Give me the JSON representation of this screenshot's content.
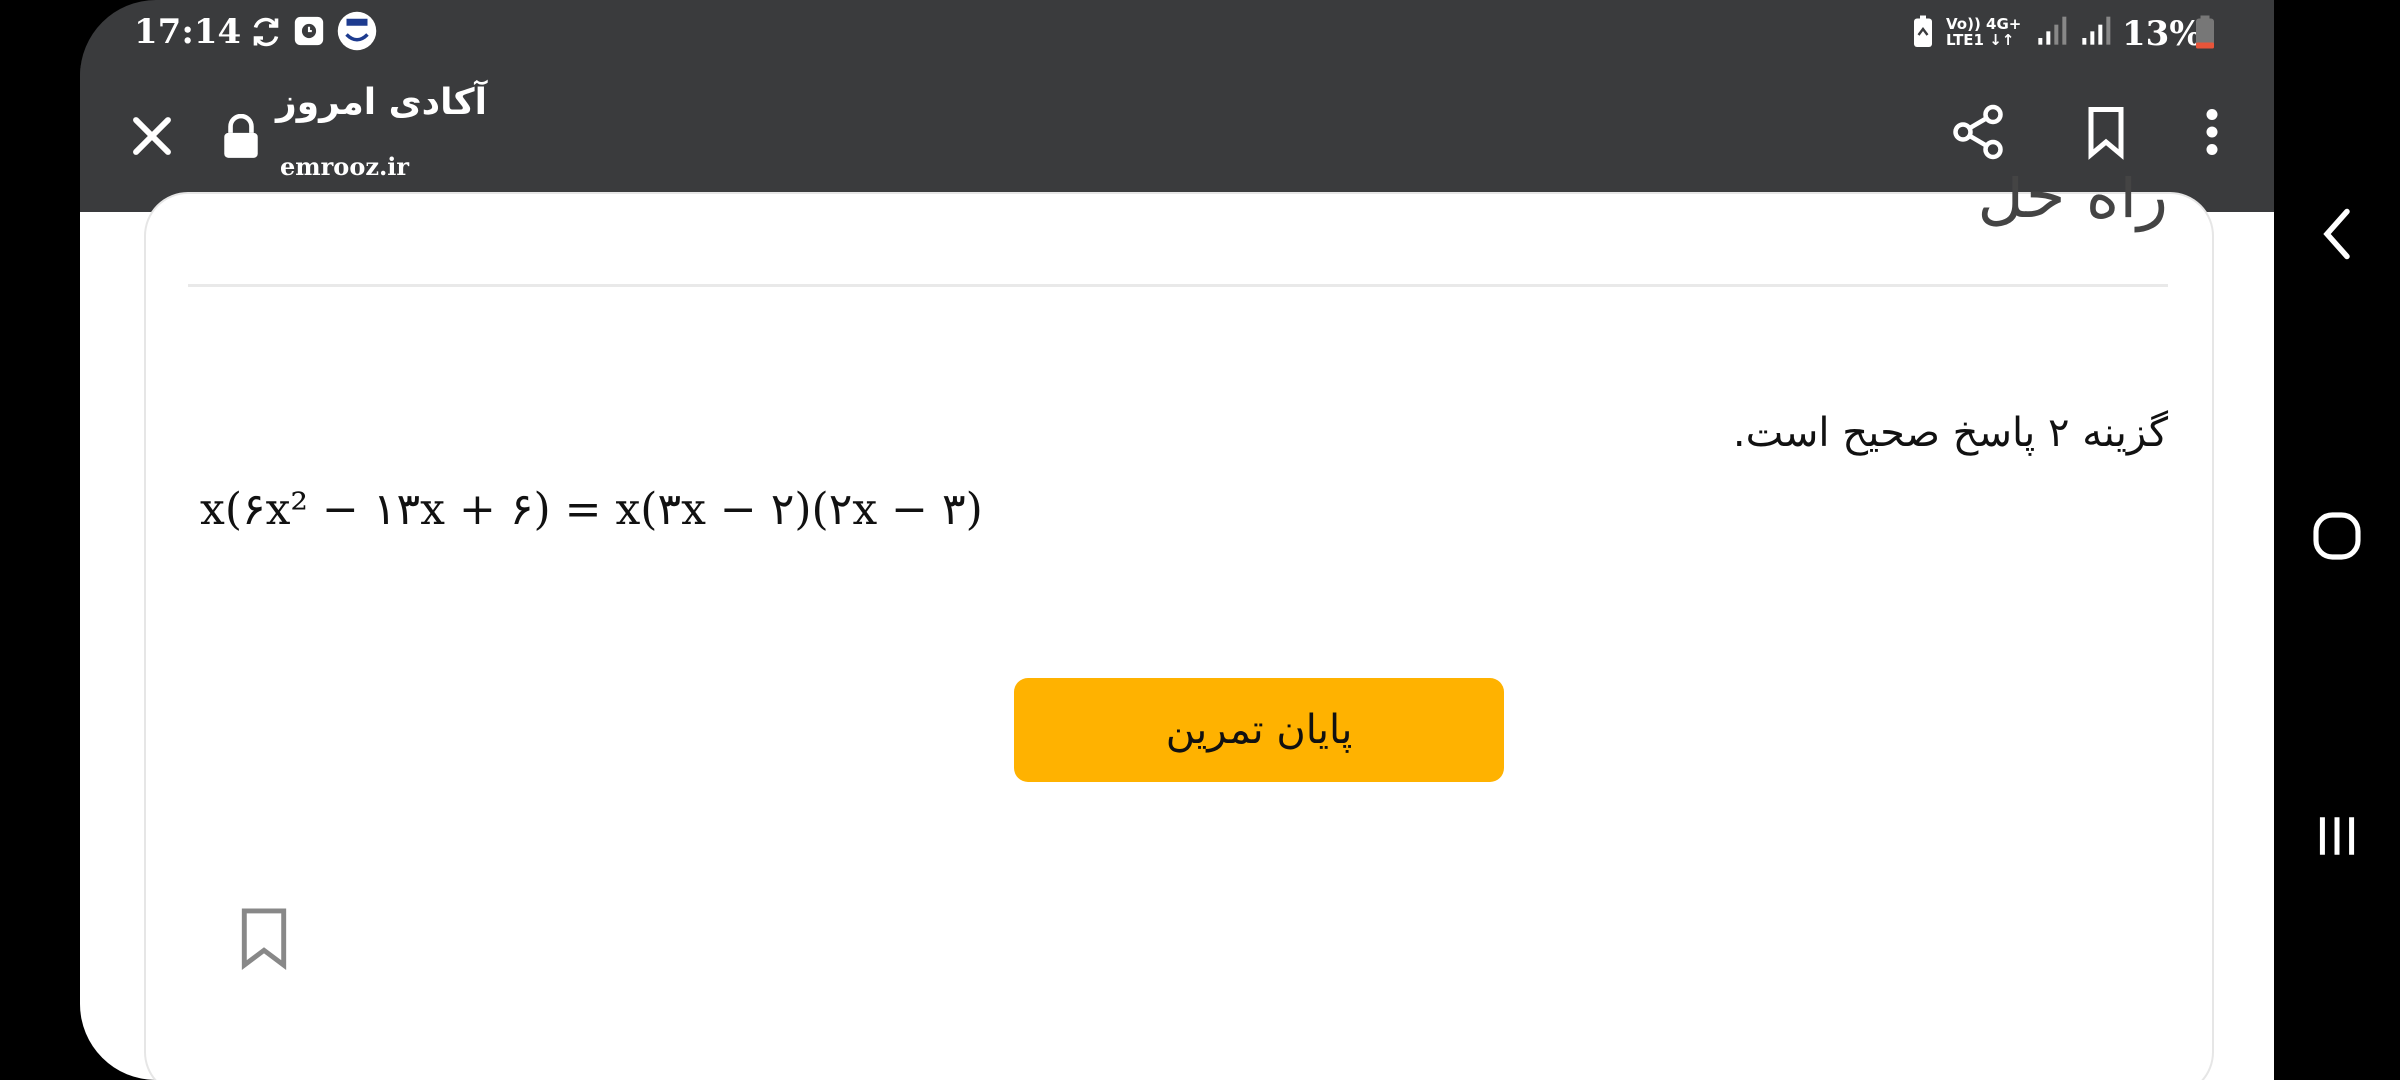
{
  "status_bar": {
    "time": "17:14",
    "network_top": "Vo)) 4G+",
    "network_bottom": "LTE1 ↓↑",
    "battery_percent": "13%"
  },
  "toolbar": {
    "title": "آکادی امروز",
    "url": "emrooz.ir",
    "icons": [
      "close-icon",
      "lock-icon",
      "share-icon",
      "bookmark-icon",
      "more-icon"
    ]
  },
  "content": {
    "heading": "راه حل",
    "answer": "گزینه ۲ پاسخ صحیح است.",
    "equation": "x(۶x² − ۱۳x + ۶) = x(۳x − ۲)(۲x − ۳)",
    "finish_button_label": "پایان تمرین"
  },
  "colors": {
    "accent": "#ffb200",
    "toolbar": "#3a3b3d"
  }
}
